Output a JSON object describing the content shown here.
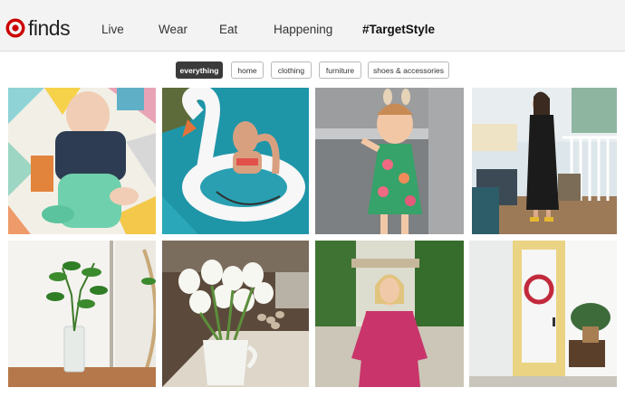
{
  "brand": {
    "logo_icon": "target-bullseye-icon",
    "name": "finds",
    "color": "#cc0000"
  },
  "nav": {
    "items": [
      {
        "label": "Live"
      },
      {
        "label": "Wear"
      },
      {
        "label": "Eat"
      },
      {
        "label": "Happening"
      },
      {
        "label": "#TargetStyle",
        "active": true
      }
    ]
  },
  "filters": {
    "items": [
      {
        "label": "everything",
        "active": true
      },
      {
        "label": "home"
      },
      {
        "label": "clothing"
      },
      {
        "label": "furniture"
      },
      {
        "label": "shoes & accessories"
      }
    ]
  },
  "gallery": {
    "tiles": [
      {
        "subject": "baby-on-blanket-photo"
      },
      {
        "subject": "woman-on-swan-float-photo"
      },
      {
        "subject": "toddler-floral-dress-photo"
      },
      {
        "subject": "woman-on-porch-photo"
      },
      {
        "subject": "plant-in-vase-photo"
      },
      {
        "subject": "tulips-in-pitcher-photo"
      },
      {
        "subject": "woman-pink-top-photo"
      },
      {
        "subject": "yellow-door-wreath-photo"
      }
    ]
  }
}
